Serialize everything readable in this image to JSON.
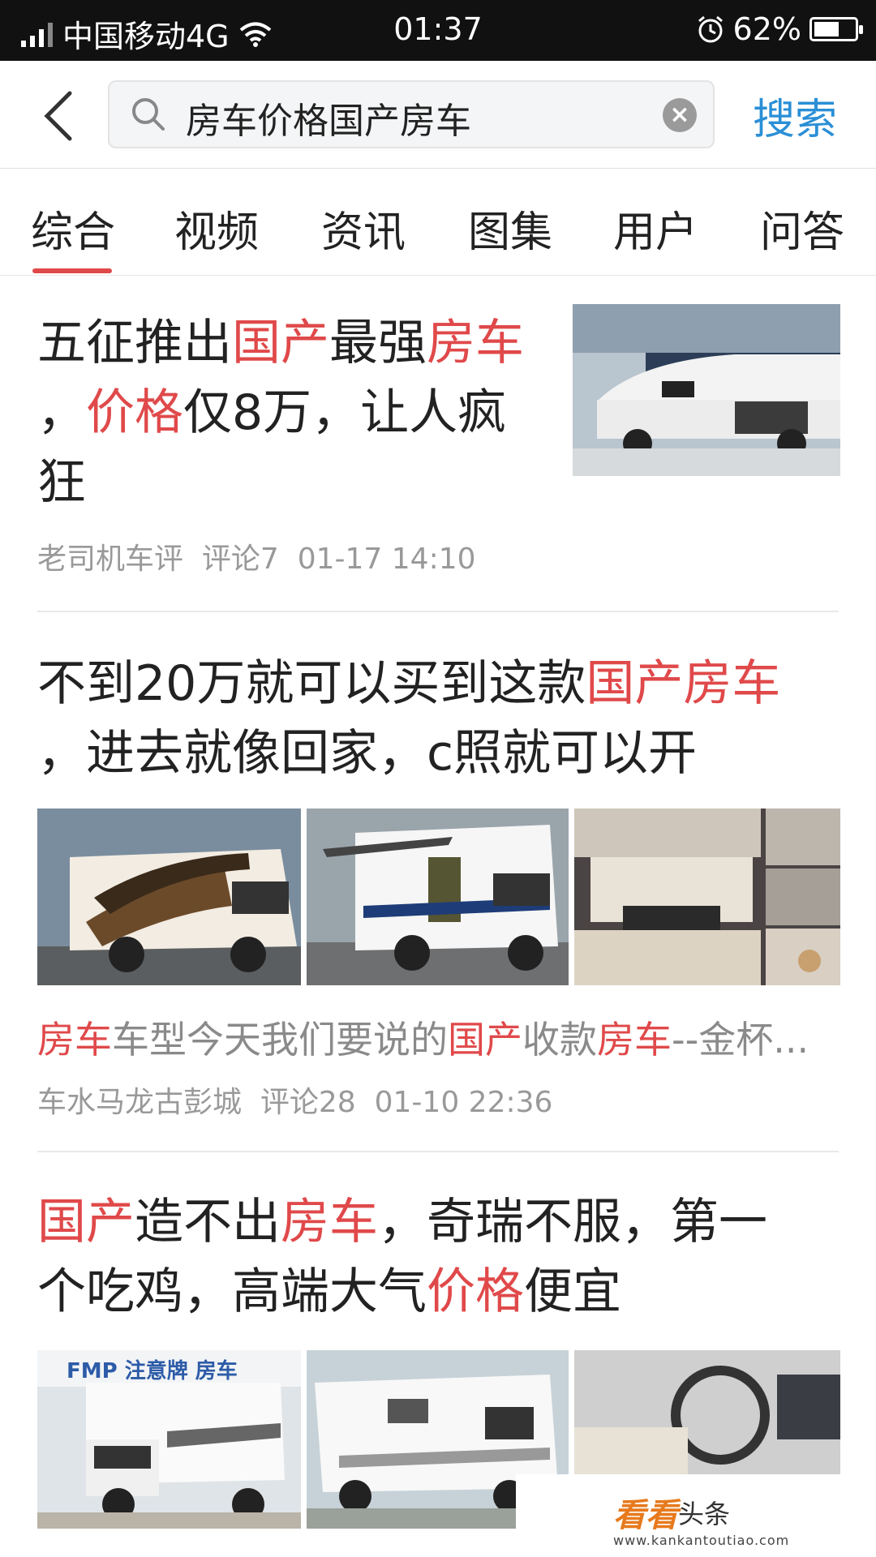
{
  "status_bar": {
    "carrier": "中国移动4G",
    "time": "01:37",
    "battery": "62%",
    "battery_level": 0.62,
    "icons": [
      "signal-icon",
      "wifi-icon",
      "alarm-icon",
      "battery-icon"
    ]
  },
  "search": {
    "query": "房车价格国产房车",
    "search_button": "搜索",
    "icons": [
      "back-arrow-icon",
      "search-icon",
      "clear-icon"
    ]
  },
  "tabs": [
    "综合",
    "视频",
    "资讯",
    "图集",
    "用户",
    "问答"
  ],
  "colors": {
    "highlight": "#e0494a",
    "accent_blue": "#2a8fd6",
    "tab_underline": "#e0494a"
  },
  "articles": [
    {
      "title_parts": [
        {
          "t": "五征推出"
        },
        {
          "t": "国产",
          "hl": true
        },
        {
          "t": "最强"
        },
        {
          "t": "房车",
          "hl": true
        },
        {
          "t": "，"
        },
        {
          "t": "价格",
          "hl": true
        },
        {
          "t": "仅8万，让人疯"
        },
        {
          "t": "狂"
        }
      ],
      "author": "老司机车评",
      "comments": "评论7",
      "date": "01-17 14:10"
    },
    {
      "title_parts": [
        {
          "t": "不到20万就可以买到这款"
        },
        {
          "t": "国产房车",
          "hl": true
        },
        {
          "t": "，进去就像回家，c照就可以开"
        }
      ],
      "summary_parts": [
        {
          "t": "房车",
          "hl": true
        },
        {
          "t": "车型今天我们要说的"
        },
        {
          "t": "国产",
          "hl": true
        },
        {
          "t": "收款"
        },
        {
          "t": "房车",
          "hl": true
        },
        {
          "t": "--金杯..."
        }
      ],
      "author": "车水马龙古彭城",
      "comments": "评论28",
      "date": "01-10 22:36"
    },
    {
      "title_parts": [
        {
          "t": "国产",
          "hl": true
        },
        {
          "t": "造不出"
        },
        {
          "t": "房车",
          "hl": true
        },
        {
          "t": "，奇瑞不服，第一"
        },
        {
          "t": "个吃鸡，高端大气"
        },
        {
          "t": "价格",
          "hl": true
        },
        {
          "t": "便宜"
        }
      ],
      "image_text": "FMP 注意牌 房车"
    }
  ],
  "watermark": {
    "brand": "看看",
    "brand2": "头条",
    "url": "www.kankantoutiao.com"
  }
}
